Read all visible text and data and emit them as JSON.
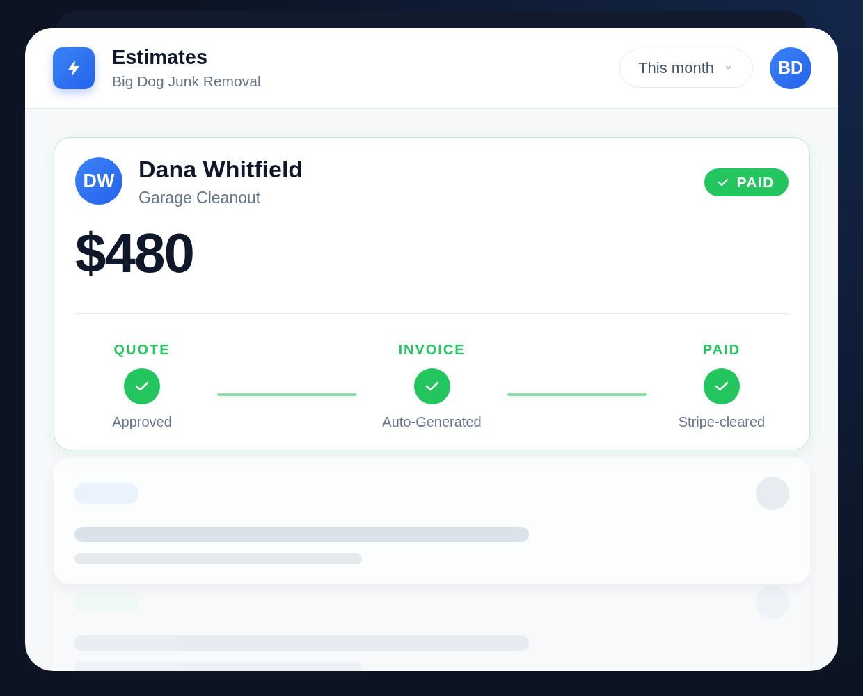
{
  "header": {
    "title": "Estimates",
    "subtitle": "Big Dog Junk Removal",
    "period": {
      "label": "This month",
      "caret": "⌄"
    },
    "user_initials": "BD"
  },
  "estimate": {
    "initials": "DW",
    "customer": "Dana Whitfield",
    "job": "Garage Cleanout",
    "status": {
      "label": "PAID",
      "paid": true
    },
    "amount": "$480",
    "steps": [
      {
        "title": "QUOTE",
        "caption": "Approved",
        "done": true
      },
      {
        "title": "INVOICE",
        "caption": "Auto-Generated",
        "done": true
      },
      {
        "title": "PAID",
        "caption": "Stripe-cleared",
        "done": true
      }
    ]
  },
  "skeleton_cards": [
    {
      "color": "#eaf2fe"
    },
    {
      "color": "#eaf8ef"
    }
  ]
}
